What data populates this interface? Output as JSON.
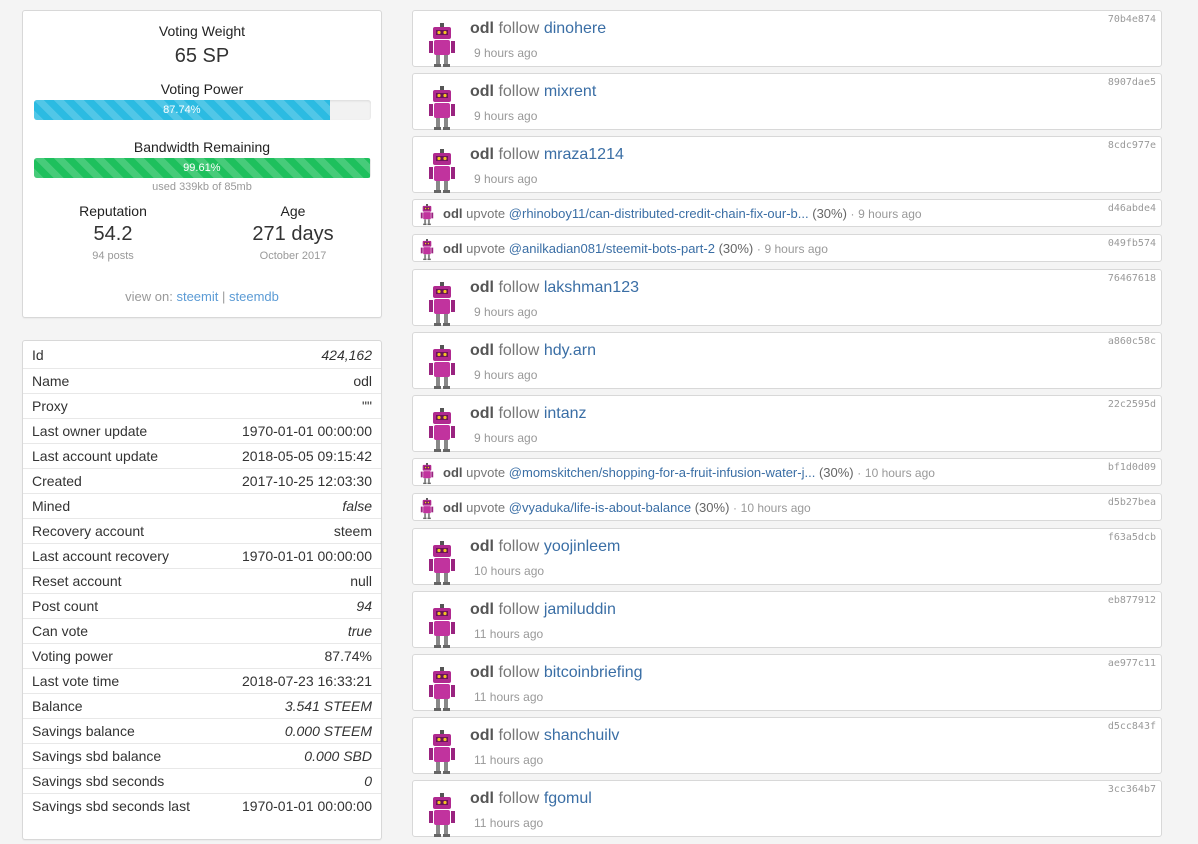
{
  "stats": {
    "voting_weight_label": "Voting Weight",
    "voting_weight_value": "65 SP",
    "voting_power_label": "Voting Power",
    "voting_power_text": "87.74%",
    "voting_power_pct": 87.74,
    "bandwidth_label": "Bandwidth Remaining",
    "bandwidth_text": "99.61%",
    "bandwidth_pct": 99.61,
    "bandwidth_note": "used 339kb of 85mb",
    "reputation_label": "Reputation",
    "reputation_value": "54.2",
    "reputation_sub": "94 posts",
    "age_label": "Age",
    "age_value": "271 days",
    "age_sub": "October 2017",
    "view_on_label": "view on:",
    "view_on_link1": "steemit",
    "view_on_sep": "|",
    "view_on_link2": "steemdb",
    "colors": {
      "voting_bar": "#2bbbe2",
      "bandwidth_bar": "#1ec05d",
      "link": "#5b9bd5"
    }
  },
  "props": [
    {
      "key": "Id",
      "value": "424,162",
      "italic": true
    },
    {
      "key": "Name",
      "value": "odl",
      "italic": false
    },
    {
      "key": "Proxy",
      "value": "\"\"",
      "italic": false
    },
    {
      "key": "Last owner update",
      "value": "1970-01-01 00:00:00",
      "italic": false
    },
    {
      "key": "Last account update",
      "value": "2018-05-05 09:15:42",
      "italic": false
    },
    {
      "key": "Created",
      "value": "2017-10-25 12:03:30",
      "italic": false
    },
    {
      "key": "Mined",
      "value": "false",
      "italic": true
    },
    {
      "key": "Recovery account",
      "value": "steem",
      "italic": false
    },
    {
      "key": "Last account recovery",
      "value": "1970-01-01 00:00:00",
      "italic": false
    },
    {
      "key": "Reset account",
      "value": "null",
      "italic": false
    },
    {
      "key": "Post count",
      "value": "94",
      "italic": true
    },
    {
      "key": "Can vote",
      "value": "true",
      "italic": true
    },
    {
      "key": "Voting power",
      "value": "87.74%",
      "italic": false
    },
    {
      "key": "Last vote time",
      "value": "2018-07-23 16:33:21",
      "italic": false
    },
    {
      "key": "Balance",
      "value": "3.541 STEEM",
      "italic": true
    },
    {
      "key": "Savings balance",
      "value": "0.000 STEEM",
      "italic": true
    },
    {
      "key": "Savings sbd balance",
      "value": "0.000 SBD",
      "italic": true
    },
    {
      "key": "Savings sbd seconds",
      "value": "0",
      "italic": true
    },
    {
      "key": "Savings sbd seconds last",
      "value": "1970-01-01 00:00:00",
      "italic": false
    }
  ],
  "feed": [
    {
      "type": "follow",
      "actor": "odl",
      "action": "follow",
      "target": "dinohere",
      "time": "9 hours ago",
      "hash": "70b4e874"
    },
    {
      "type": "follow",
      "actor": "odl",
      "action": "follow",
      "target": "mixrent",
      "time": "9 hours ago",
      "hash": "8907dae5"
    },
    {
      "type": "follow",
      "actor": "odl",
      "action": "follow",
      "target": "mraza1214",
      "time": "9 hours ago",
      "hash": "8cdc977e"
    },
    {
      "type": "upvote",
      "actor": "odl",
      "action": "upvote",
      "target": "@rhinoboy11/can-distributed-credit-chain-fix-our-b...",
      "pct": "(30%)",
      "sep": "·",
      "time": "9 hours ago",
      "hash": "d46abde4"
    },
    {
      "type": "upvote",
      "actor": "odl",
      "action": "upvote",
      "target": "@anilkadian081/steemit-bots-part-2",
      "pct": "(30%)",
      "sep": "·",
      "time": "9 hours ago",
      "hash": "049fb574"
    },
    {
      "type": "follow",
      "actor": "odl",
      "action": "follow",
      "target": "lakshman123",
      "time": "9 hours ago",
      "hash": "76467618"
    },
    {
      "type": "follow",
      "actor": "odl",
      "action": "follow",
      "target": "hdy.arn",
      "time": "9 hours ago",
      "hash": "a860c58c"
    },
    {
      "type": "follow",
      "actor": "odl",
      "action": "follow",
      "target": "intanz",
      "time": "9 hours ago",
      "hash": "22c2595d"
    },
    {
      "type": "upvote",
      "actor": "odl",
      "action": "upvote",
      "target": "@momskitchen/shopping-for-a-fruit-infusion-water-j...",
      "pct": "(30%)",
      "sep": "·",
      "time": "10 hours ago",
      "hash": "bf1d0d09"
    },
    {
      "type": "upvote",
      "actor": "odl",
      "action": "upvote",
      "target": "@vyaduka/life-is-about-balance",
      "pct": "(30%)",
      "sep": "·",
      "time": "10 hours ago",
      "hash": "d5b27bea"
    },
    {
      "type": "follow",
      "actor": "odl",
      "action": "follow",
      "target": "yoojinleem",
      "time": "10 hours ago",
      "hash": "f63a5dcb"
    },
    {
      "type": "follow",
      "actor": "odl",
      "action": "follow",
      "target": "jamiluddin",
      "time": "11 hours ago",
      "hash": "eb877912"
    },
    {
      "type": "follow",
      "actor": "odl",
      "action": "follow",
      "target": "bitcoinbriefing",
      "time": "11 hours ago",
      "hash": "ae977c11"
    },
    {
      "type": "follow",
      "actor": "odl",
      "action": "follow",
      "target": "shanchuilv",
      "time": "11 hours ago",
      "hash": "d5cc843f"
    },
    {
      "type": "follow",
      "actor": "odl",
      "action": "follow",
      "target": "fgomul",
      "time": "11 hours ago",
      "hash": "3cc364b7"
    }
  ]
}
